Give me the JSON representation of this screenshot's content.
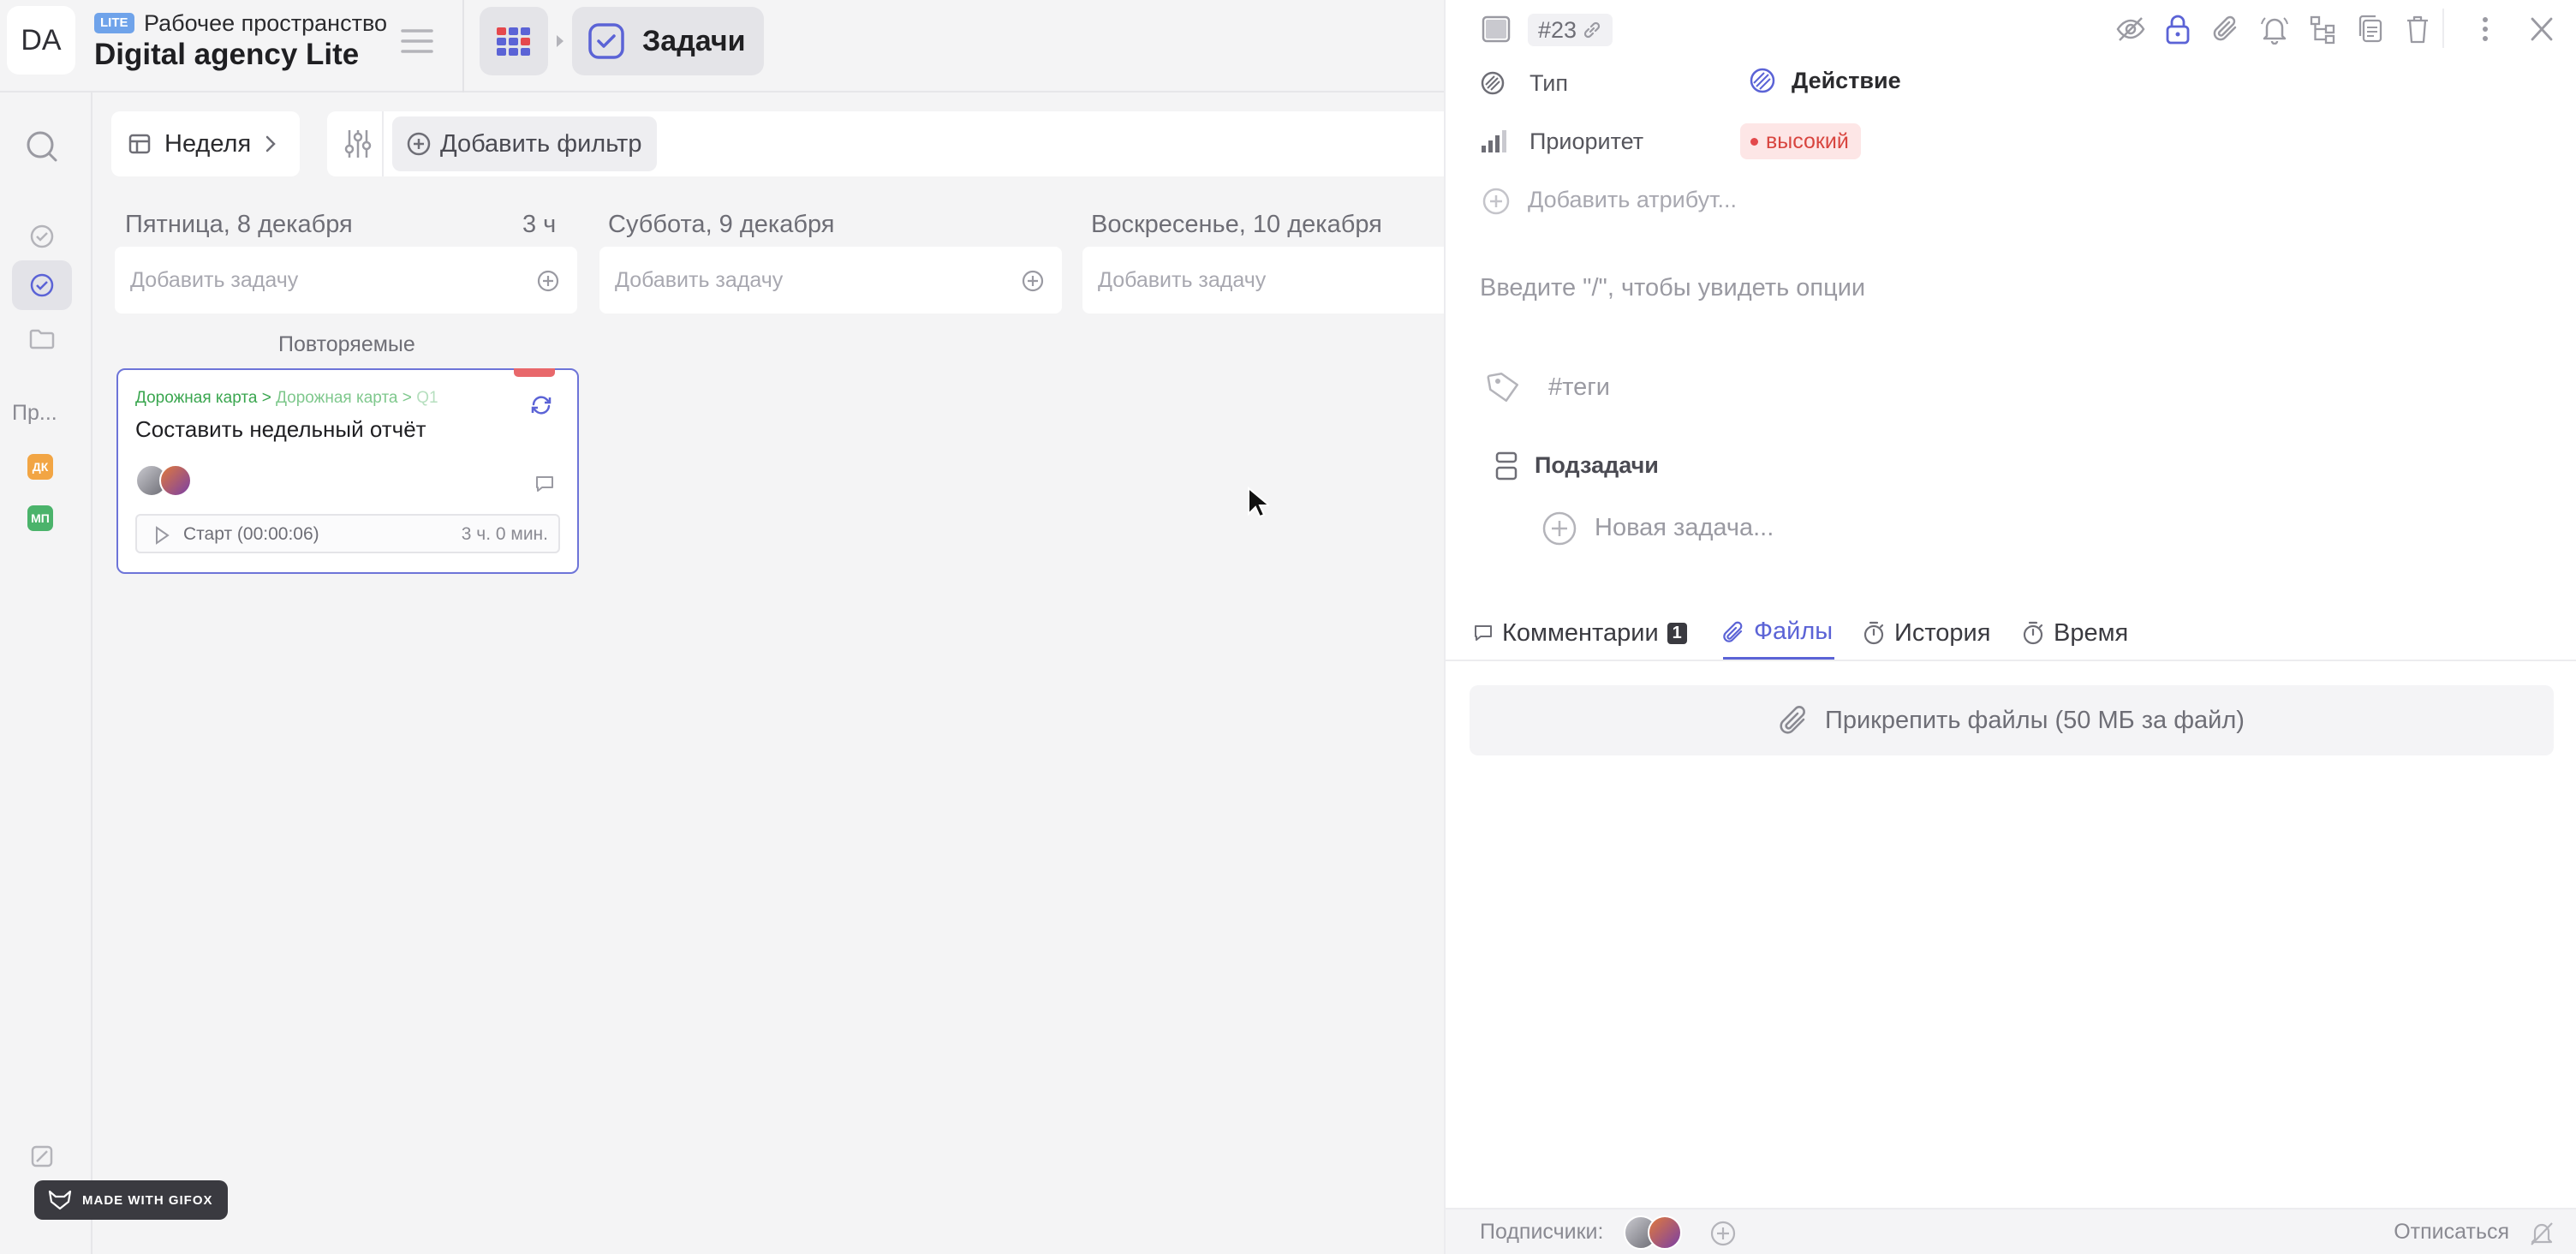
{
  "workspace": {
    "avatar_initials": "DA",
    "badge": "LITE",
    "label": "Рабочее пространство",
    "name": "Digital agency Lite"
  },
  "breadcrumb": {
    "current": "Задачи"
  },
  "rail": {
    "projects_title": "Пр...",
    "projects": [
      {
        "label": "ДК",
        "color": "#f2a544"
      },
      {
        "label": "МП",
        "color": "#4bb36b"
      }
    ]
  },
  "toolbar": {
    "view_label": "Неделя",
    "add_filter_label": "Добавить фильтр"
  },
  "board": {
    "add_task_placeholder": "Добавить задачу",
    "days": [
      {
        "title": "Пятница, 8 декабря",
        "hours": "3 ч"
      },
      {
        "title": "Суббота, 9 декабря",
        "hours": ""
      },
      {
        "title": "Воскресенье, 10 декабря",
        "hours": ""
      }
    ],
    "group_label": "Повторяемые",
    "card": {
      "path": [
        "Дорожная карта",
        "Дорожная карта",
        "Q1"
      ],
      "path_separator": ">",
      "title": "Составить недельный отчёт",
      "timer_start": "Старт (00:00:06)",
      "timer_spent": "3 ч. 0 мин."
    }
  },
  "panel": {
    "task_id": "#23",
    "attributes": [
      {
        "label": "Тип",
        "value": "Действие"
      },
      {
        "label": "Приоритет",
        "value": "высокий"
      }
    ],
    "add_attribute": "Добавить атрибут...",
    "editor_placeholder": "Введите \"/\", чтобы увидеть опции",
    "tags_placeholder": "#теги",
    "subtasks_title": "Подзадачи",
    "new_subtask_placeholder": "Новая задача...",
    "tabs": [
      {
        "label": "Комментарии",
        "count": "1"
      },
      {
        "label": "Файлы",
        "count": ""
      },
      {
        "label": "История",
        "count": ""
      },
      {
        "label": "Время",
        "count": ""
      }
    ],
    "active_tab": "Файлы",
    "attach_label": "Прикрепить файлы (50 МБ за файл)",
    "subscribers_label": "Подписчики:",
    "unsubscribe_label": "Отписаться"
  },
  "watermark": "MADE WITH GIFOX",
  "colors": {
    "accent": "#5b63d6",
    "priority_high": "#d8453f",
    "path_green": "#3aa64f"
  }
}
